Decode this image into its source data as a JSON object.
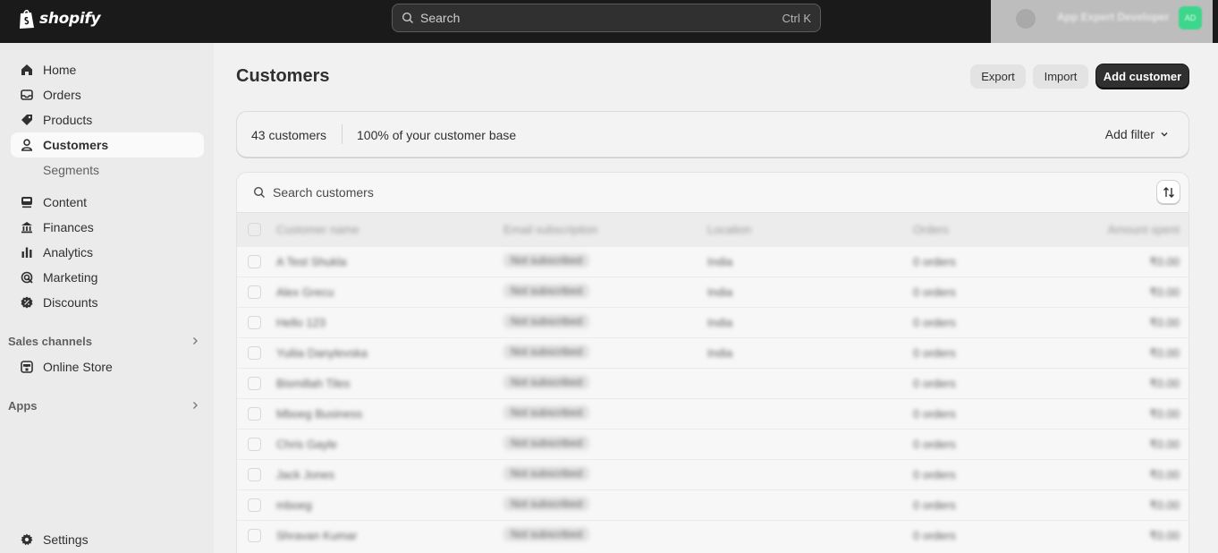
{
  "topbar": {
    "brand": "shopify",
    "search_placeholder": "Search",
    "search_shortcut": "Ctrl K",
    "store_name": "App Expert Developer",
    "avatar_initials": "AD"
  },
  "sidebar": {
    "items": [
      {
        "label": "Home"
      },
      {
        "label": "Orders"
      },
      {
        "label": "Products"
      },
      {
        "label": "Customers"
      },
      {
        "label": "Segments"
      },
      {
        "label": "Content"
      },
      {
        "label": "Finances"
      },
      {
        "label": "Analytics"
      },
      {
        "label": "Marketing"
      },
      {
        "label": "Discounts"
      }
    ],
    "sales_channels_label": "Sales channels",
    "online_store_label": "Online Store",
    "apps_label": "Apps",
    "settings_label": "Settings"
  },
  "page": {
    "title": "Customers",
    "export_label": "Export",
    "import_label": "Import",
    "add_customer_label": "Add customer"
  },
  "summary": {
    "count": "43 customers",
    "base": "100% of your customer base",
    "add_filter": "Add filter"
  },
  "table": {
    "search_placeholder": "Search customers",
    "headers": {
      "name": "Customer name",
      "email": "Email subscription",
      "location": "Location",
      "orders": "Orders",
      "amount": "Amount spent"
    },
    "rows": [
      {
        "name": "A Test Shukla",
        "email": "Not subscribed",
        "location": "India",
        "orders": "0 orders",
        "amount": "₹0.00"
      },
      {
        "name": "Alex Grecu",
        "email": "Not subscribed",
        "location": "India",
        "orders": "0 orders",
        "amount": "₹0.00"
      },
      {
        "name": "Hello 123",
        "email": "Not subscribed",
        "location": "India",
        "orders": "0 orders",
        "amount": "₹0.00"
      },
      {
        "name": "Yuliia Danylevska",
        "email": "Not subscribed",
        "location": "India",
        "orders": "0 orders",
        "amount": "₹0.00"
      },
      {
        "name": "Bismillah Tiles",
        "email": "Not subscribed",
        "location": "",
        "orders": "0 orders",
        "amount": "₹0.00"
      },
      {
        "name": "Mboeg Business",
        "email": "Not subscribed",
        "location": "",
        "orders": "0 orders",
        "amount": "₹0.00"
      },
      {
        "name": "Chris Gayle",
        "email": "Not subscribed",
        "location": "",
        "orders": "0 orders",
        "amount": "₹0.00"
      },
      {
        "name": "Jack Jones",
        "email": "Not subscribed",
        "location": "",
        "orders": "0 orders",
        "amount": "₹0.00"
      },
      {
        "name": "mboeg",
        "email": "Not subscribed",
        "location": "",
        "orders": "0 orders",
        "amount": "₹0.00"
      },
      {
        "name": "Shravan Kumar",
        "email": "Not subscribed",
        "location": "",
        "orders": "0 orders",
        "amount": "₹0.00"
      }
    ]
  }
}
